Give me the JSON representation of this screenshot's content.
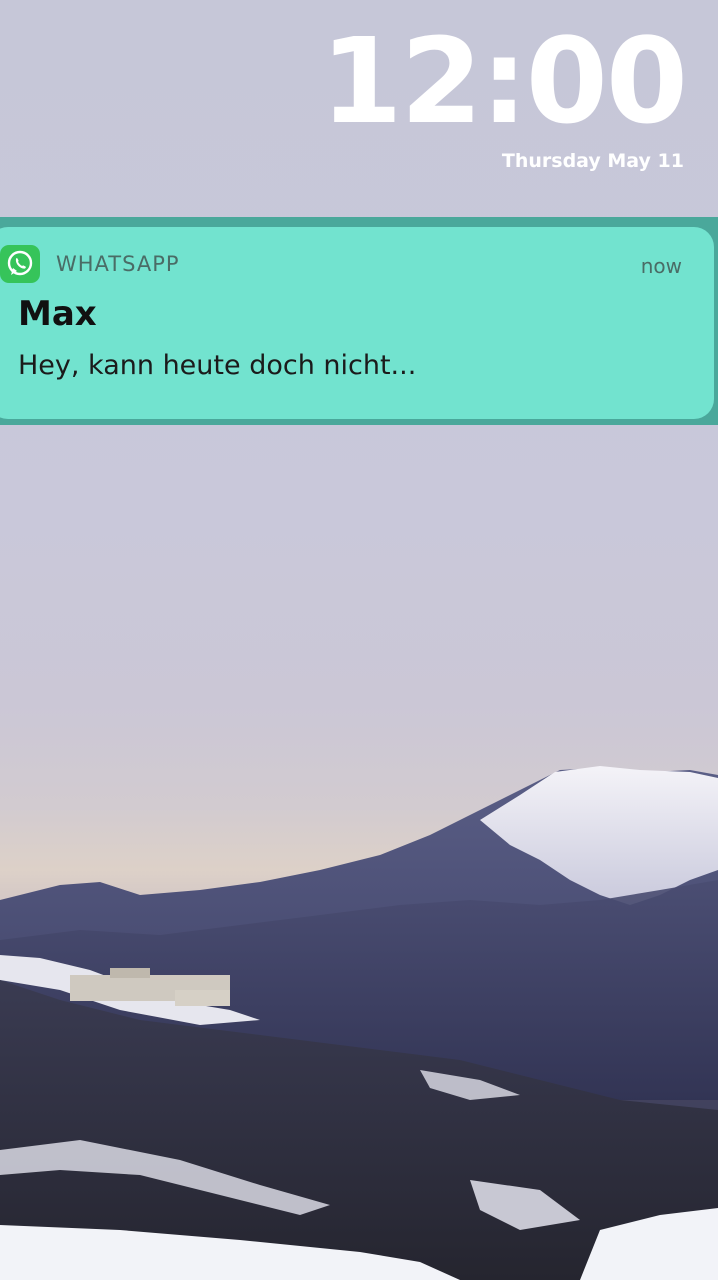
{
  "lock_screen": {
    "time": "12:00",
    "date": "Thursday May 11"
  },
  "notification": {
    "app_name": "WHATSAPP",
    "time_ago": "now",
    "sender": "Max",
    "message": "Hey, kann heute doch nicht...",
    "app_icon": "whatsapp-icon",
    "background_color": "#72e3cf"
  },
  "wallpaper": {
    "description_icon": "snowy-mountain-landscape"
  }
}
